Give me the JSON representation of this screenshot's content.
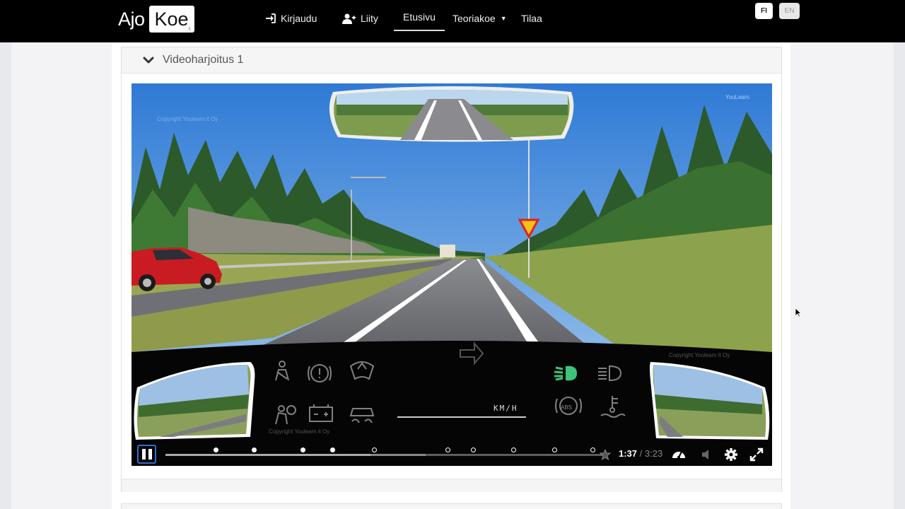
{
  "navbar": {
    "logo_part1": "Ajo",
    "logo_part2": "Koe",
    "logo_suffix": ".fi",
    "items": [
      {
        "label": "Kirjaudu",
        "icon": "sign-in-icon"
      },
      {
        "label": "Liity",
        "icon": "user-plus-icon"
      },
      {
        "label": "Etusivu",
        "active": true
      },
      {
        "label": "Teoriakoe",
        "dropdown": true
      },
      {
        "label": "Tilaa"
      }
    ],
    "languages": [
      "FI",
      "EN"
    ],
    "selected_language": "FI"
  },
  "panel": {
    "title": "Videoharjoitus 1",
    "expanded": true
  },
  "video": {
    "watermark_brand": "YouLearn",
    "watermark_copyright": "Copyright Youlearn it Oy",
    "speed_unit": "KM/H",
    "current_time": "1:37",
    "separator": " / ",
    "duration": "3:23",
    "progress": 0.478,
    "markers": [
      {
        "at": 0.115,
        "filled": true
      },
      {
        "at": 0.202,
        "filled": true
      },
      {
        "at": 0.313,
        "filled": true
      },
      {
        "at": 0.381,
        "filled": true
      },
      {
        "at": 0.477,
        "filled": false
      },
      {
        "at": 0.645,
        "filled": false
      },
      {
        "at": 0.703,
        "filled": false
      },
      {
        "at": 0.795,
        "filled": false
      },
      {
        "at": 0.888,
        "filled": false
      },
      {
        "at": 0.975,
        "filled": false
      }
    ],
    "active_indicator": "low-beam-headlight",
    "colors": {
      "active_indicator": "#3cc47a",
      "pause_border": "#2b6fd0"
    }
  }
}
